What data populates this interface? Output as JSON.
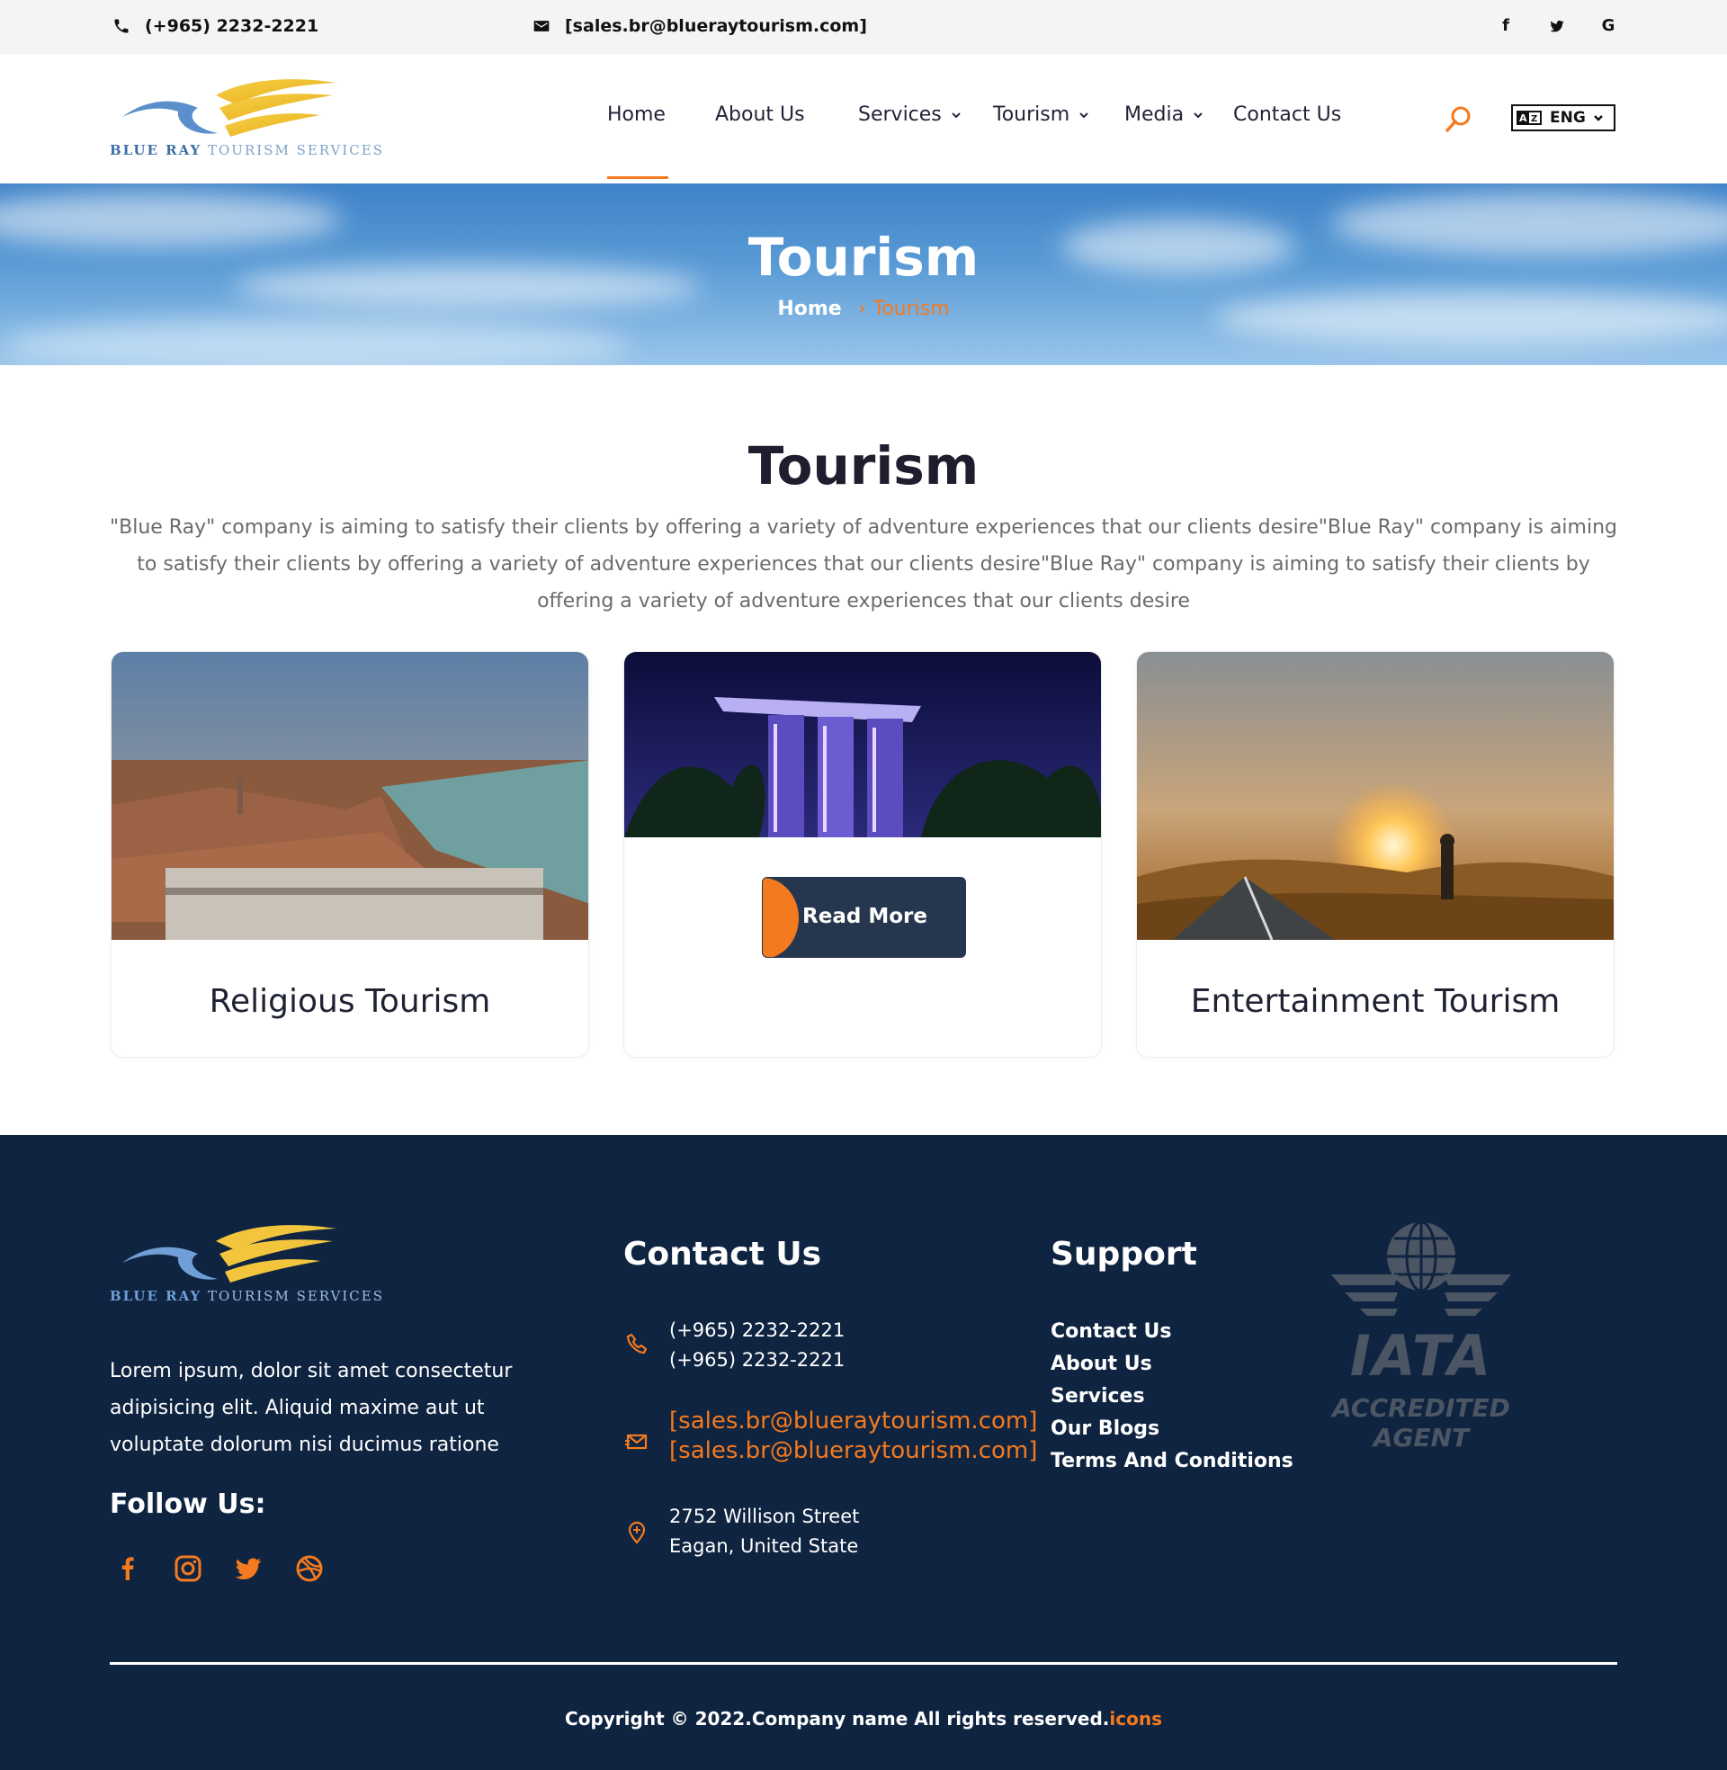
{
  "topbar": {
    "phone": "(+965) 2232-2221",
    "email": "[sales.br@blueraytourism.com]",
    "social_icons": [
      "facebook-icon",
      "twitter-icon",
      "google-icon"
    ]
  },
  "brand": {
    "logo_bold": "BLUE RAY",
    "logo_rest": "TOURISM SERVICES",
    "colors": {
      "accent": "#f47a1f",
      "navy": "#0f2440",
      "button": "#27364f"
    }
  },
  "nav": {
    "items": [
      {
        "label": "Home",
        "active": true,
        "dropdown": false
      },
      {
        "label": "About Us",
        "dropdown": false
      },
      {
        "label": "Services",
        "dropdown": true
      },
      {
        "label": "Tourism",
        "dropdown": true
      },
      {
        "label": "Media",
        "dropdown": true
      },
      {
        "label": "Contact Us",
        "dropdown": false
      }
    ],
    "language": "ENG"
  },
  "hero": {
    "title": "Tourism",
    "breadcrumb_home": "Home",
    "breadcrumb_current": "Tourism"
  },
  "intro": {
    "title": "Tourism",
    "text": "\"Blue Ray\" company is aiming to satisfy their clients by offering a variety of adventure experiences that our clients desire\"Blue Ray\" company is aiming to satisfy their clients by offering a variety of adventure experiences that our clients desire\"Blue Ray\" company is aiming to satisfy their clients by offering a variety of adventure experiences that our clients desire"
  },
  "cards": [
    {
      "title": "Religious Tourism"
    },
    {
      "button_label": "Read More"
    },
    {
      "title": "Entertainment Tourism"
    }
  ],
  "footer": {
    "about": "Lorem ipsum, dolor sit amet consectetur adipisicing elit. Aliquid maxime aut ut voluptate dolorum nisi ducimus ratione",
    "follow_title": "Follow Us:",
    "social_icons": [
      "facebook-icon",
      "instagram-icon",
      "twitter-icon",
      "dribbble-icon"
    ],
    "contact_title": "Contact Us",
    "phones": [
      "(+965) 2232-2221",
      "(+965) 2232-2221"
    ],
    "emails": [
      "[sales.br@blueraytourism.com]",
      "[sales.br@blueraytourism.com]"
    ],
    "address_line1": "2752 Willison Street",
    "address_line2": "Eagan, United State",
    "support_title": "Support",
    "support_links": [
      "Contact Us",
      "About Us",
      "Services",
      "Our Blogs",
      "Terms And Conditions"
    ],
    "badge_title": "IATA",
    "badge_subtitle": "ACCREDITED AGENT",
    "copyright": "Copyright © 2022.Company name All rights reserved.",
    "copyright_accent": "icons"
  }
}
